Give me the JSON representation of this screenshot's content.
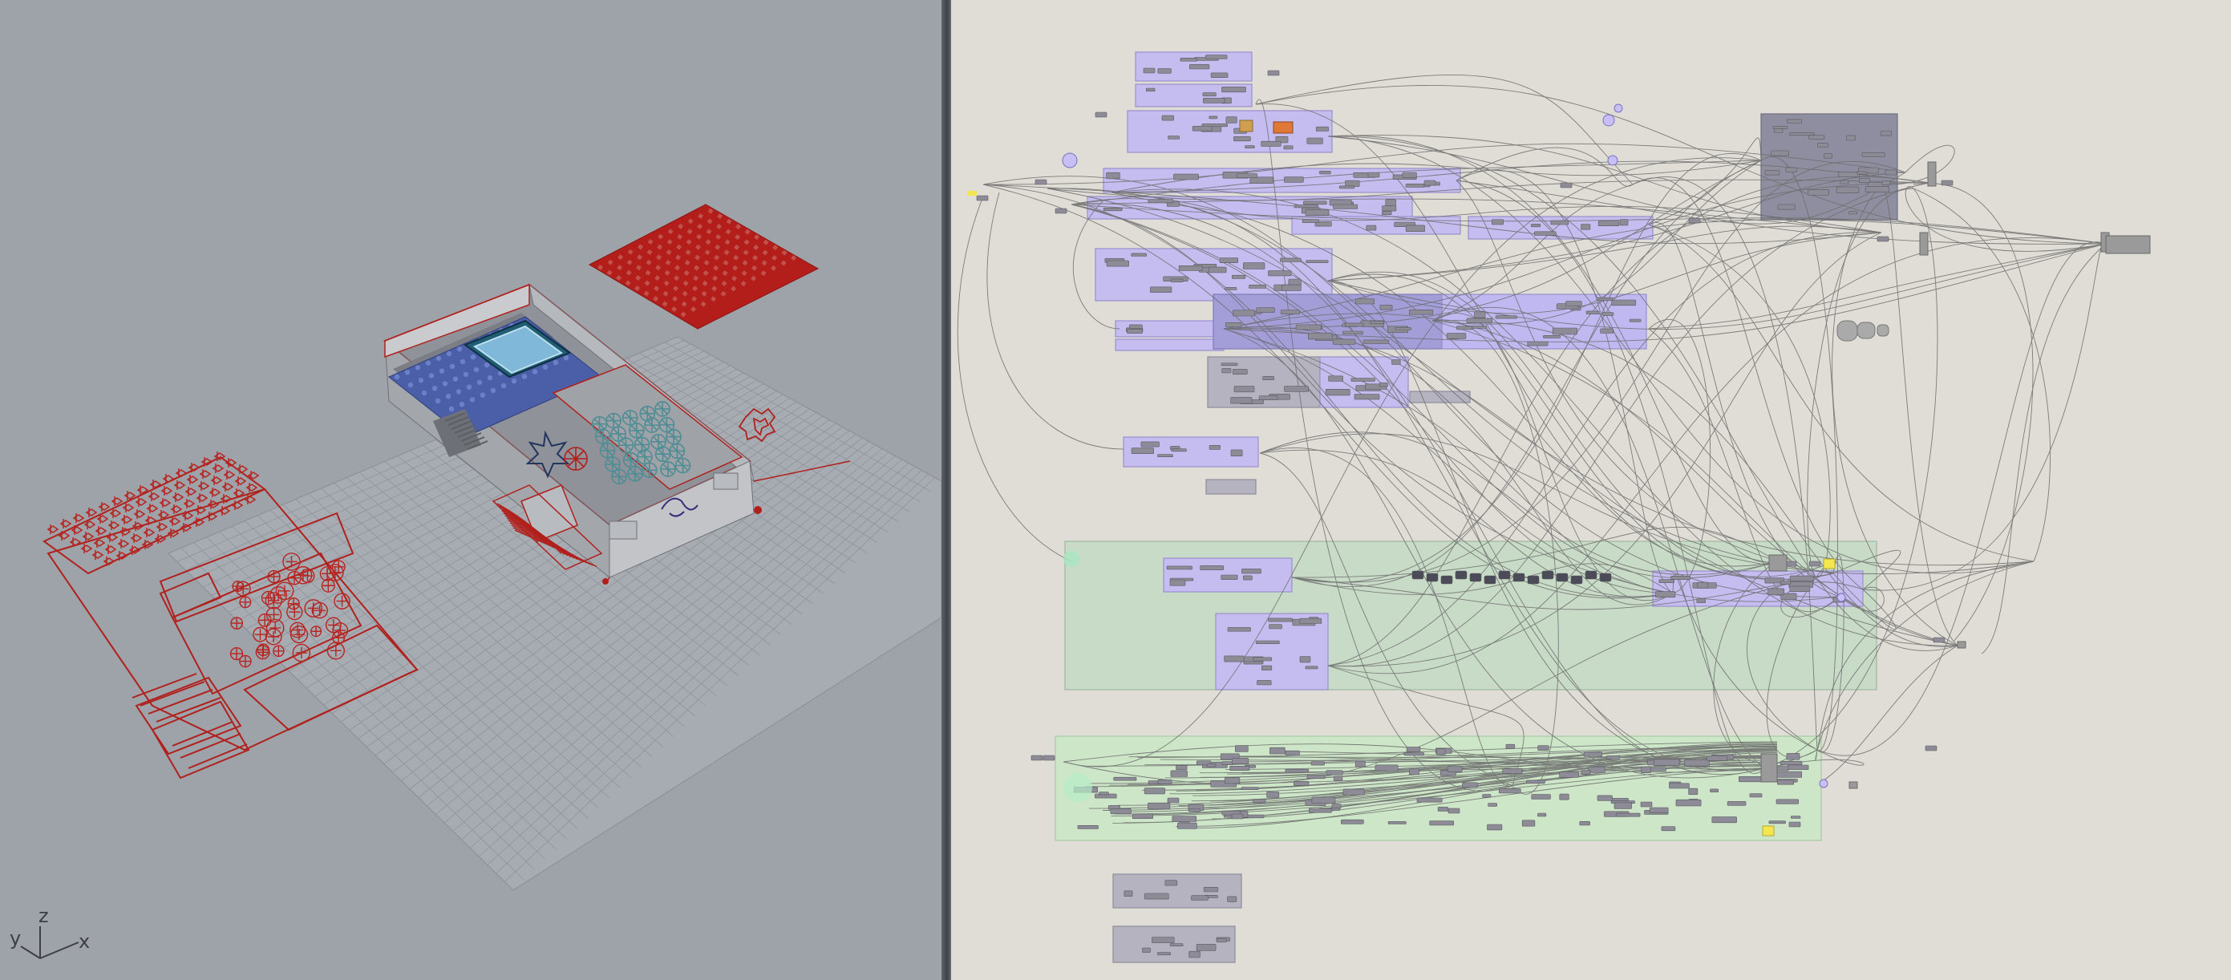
{
  "viewport": {
    "axis": {
      "x": "x",
      "y": "y",
      "z": "z"
    }
  },
  "colors": {
    "viewport_bg": "#9ea2a9",
    "selection_red": "#b0201c",
    "grid": "#8e9298",
    "canvas_bg": "#e0ddd6",
    "group_purple": "#c5bdf0",
    "group_green": "#c7dbc7",
    "group_light_green": "#cde6c7",
    "group_dark": "#8f8ea0",
    "wire": "#6b6b6b",
    "panel_yellow": "#f4e650"
  },
  "icons": [
    "axis-gizmo-icon"
  ]
}
